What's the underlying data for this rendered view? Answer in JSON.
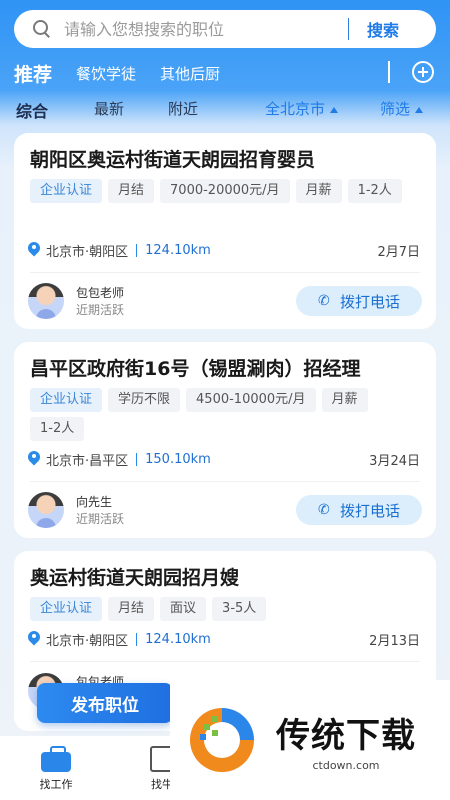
{
  "search": {
    "placeholder": "请输入您想搜索的职位",
    "button_label": "搜索"
  },
  "categories": {
    "active": "推荐",
    "items": [
      "餐饮学徒",
      "其他后厨"
    ]
  },
  "filters": {
    "active": "综合",
    "items": [
      "最新",
      "附近"
    ],
    "city": "全北京市",
    "screen": "筛选"
  },
  "jobs": [
    {
      "title": "朝阳区奥运村街道天朗园招育婴员",
      "tags": [
        "企业认证",
        "月结",
        "7000-20000元/月",
        "月薪",
        "1-2人"
      ],
      "location": "北京市·朝阳区",
      "distance": "124.10km",
      "date": "2月7日",
      "contact_name": "包包老师",
      "contact_status": "近期活跃",
      "call_label": "拨打电话"
    },
    {
      "title": "昌平区政府街16号（锡盟涮肉）招经理",
      "tags": [
        "企业认证",
        "学历不限",
        "4500-10000元/月",
        "月薪",
        "1-2人"
      ],
      "location": "北京市·昌平区",
      "distance": "150.10km",
      "date": "3月24日",
      "contact_name": "向先生",
      "contact_status": "近期活跃",
      "call_label": "拨打电话"
    },
    {
      "title": "奥运村街道天朗园招月嫂",
      "tags": [
        "企业认证",
        "月结",
        "面议",
        "3-5人"
      ],
      "location": "北京市·朝阳区",
      "distance": "124.10km",
      "date": "2月13日",
      "contact_name": "包包老师"
    }
  ],
  "post_button": "发布职位",
  "bottom_nav": {
    "find_job": "找工作",
    "second": "找牛"
  },
  "watermark": {
    "title": "传统下载",
    "url": "ctdown.com"
  },
  "colors": {
    "primary": "#1f7be8",
    "header_gradient_top": "#2f93f5",
    "page_bg": "#eef3f8"
  }
}
